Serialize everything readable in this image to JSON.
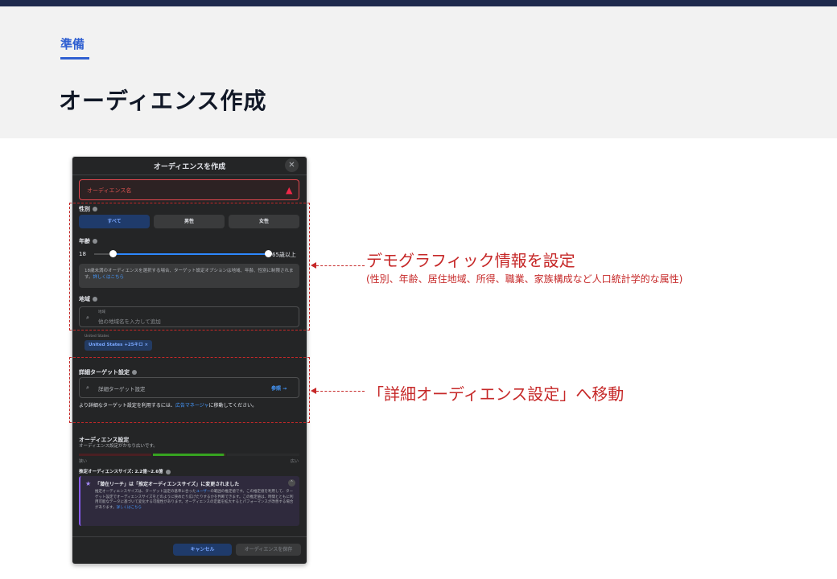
{
  "header": {
    "section": "準備",
    "title": "オーディエンス作成"
  },
  "dialog": {
    "title": "オーディエンスを作成",
    "close_glyph": "✕",
    "name_placeholder": "オーディエンス名",
    "gender": {
      "label": "性別",
      "options": [
        "すべて",
        "男性",
        "女性"
      ],
      "selected": "すべて"
    },
    "age": {
      "label": "年齢",
      "min": "18",
      "max": "65歳以上",
      "note": "18歳未満のオーディエンスを選択する場合、ターゲット設定オプションは地域、年齢、性別に制限されます。",
      "note_link": "詳しくはこちら"
    },
    "location": {
      "label": "地域",
      "field_small_label": "地域",
      "placeholder": "他の地域名を入力して追加",
      "country_label": "United States",
      "chip": "United States +25キロ ×"
    },
    "detailed": {
      "label": "詳細ターゲット設定",
      "placeholder": "詳細ターゲット設定",
      "browse": "参照 →",
      "help_prefix": "より詳細なターゲット設定を利用するには、",
      "help_link": "広告マネージャ",
      "help_suffix": "に移動してください。"
    },
    "audience": {
      "title": "オーディエンス設定",
      "subtitle": "オーディエンス設定がかなり広いです。",
      "narrow": "狭い",
      "wide": "広い",
      "estimate": "推定オーディエンスサイズ: 2.2億~2.6億",
      "notice_title": "「潜在リーチ」は「推定オーディエンスサイズ」に変更されました",
      "notice_body_1": "推定オーディエンスサイズは、ターゲット設定の基準に合った",
      "notice_body_link": "ユーザー",
      "notice_body_2": "の範囲の推定値です。この推定値を利用して、ターゲット設定でオーディエンスサイズをどのように狭めたり広げたりするかを判断できます。この推定値は、時間とともに利用可能なデータに基づいて変化する可能性があります。オーディエンスの定義を拡大するとパフォーマンスが改善する場合があります。",
      "notice_link": "詳しくはこちら"
    },
    "buttons": {
      "cancel": "キャンセル",
      "save": "オーディエンスを保存"
    }
  },
  "annotations": {
    "demographic_title": "デモグラフィック情報を設定",
    "demographic_sub": "(性別、年齢、居住地域、所得、職業、家族構成など人口統計学的な属性)",
    "detailed_move": "「詳細オーディエンス設定」へ移動"
  },
  "colors": {
    "section_accent": "#2f5fd1",
    "annotation_red": "#c62828",
    "dialog_bg": "#242526"
  }
}
